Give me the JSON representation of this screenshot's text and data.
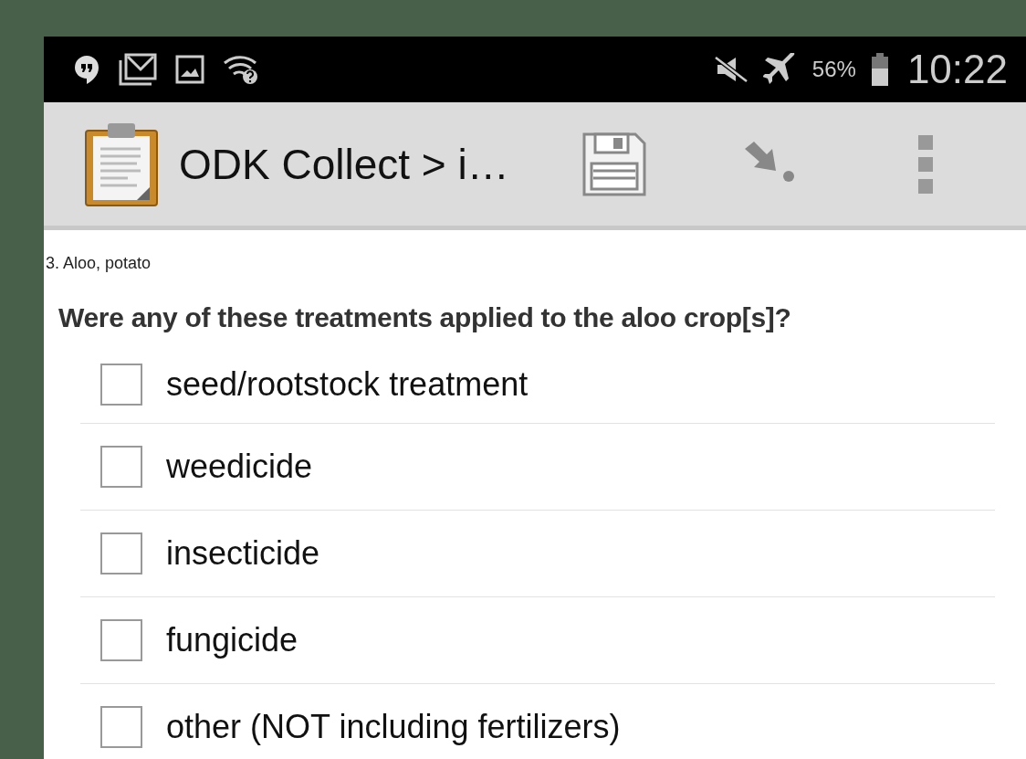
{
  "status_bar": {
    "battery_text": "56%",
    "time": "10:22"
  },
  "action_bar": {
    "title": "ODK Collect > i…"
  },
  "form": {
    "group": "3. Aloo, potato",
    "question": "Were any of these treatments applied to the aloo crop[s]?",
    "options": [
      {
        "label": "seed/rootstock treatment",
        "checked": false
      },
      {
        "label": "weedicide",
        "checked": false
      },
      {
        "label": "insecticide",
        "checked": false
      },
      {
        "label": "fungicide",
        "checked": false
      },
      {
        "label": "other (NOT including fertilizers)",
        "checked": false
      }
    ]
  }
}
